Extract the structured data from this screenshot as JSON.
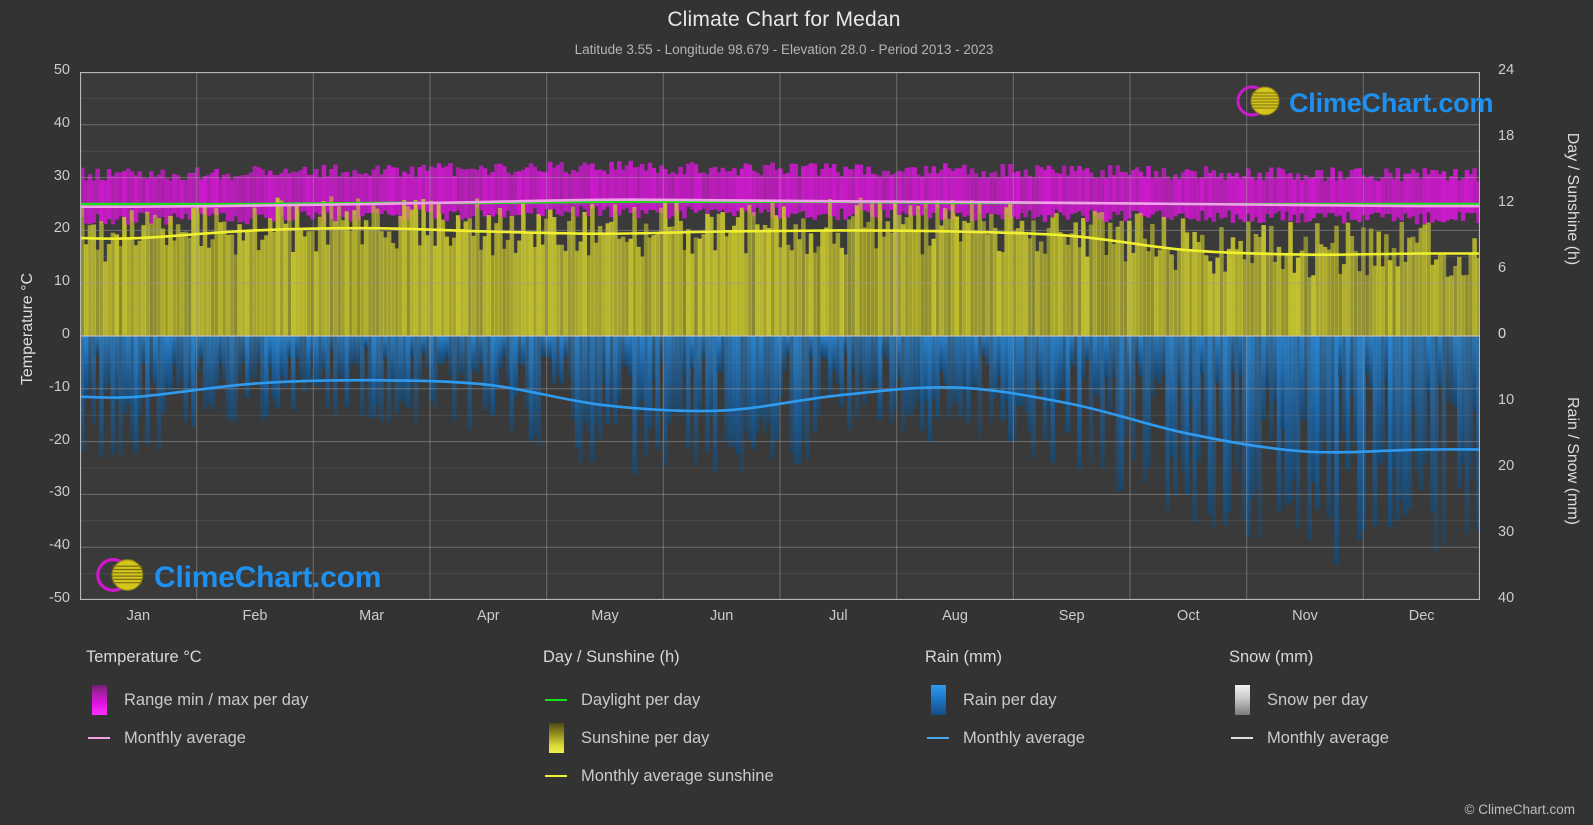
{
  "header": {
    "title": "Climate Chart for Medan",
    "subtitle": "Latitude 3.55 - Longitude 98.679 - Elevation 28.0 - Period 2013 - 2023"
  },
  "axes": {
    "left_title": "Temperature °C",
    "right_top_title": "Day / Sunshine (h)",
    "right_bottom_title": "Rain / Snow (mm)",
    "left_ticks": [
      "50",
      "40",
      "30",
      "20",
      "10",
      "0",
      "-10",
      "-20",
      "-30",
      "-40",
      "-50"
    ],
    "right_top_ticks": [
      "24",
      "18",
      "12",
      "6",
      "0"
    ],
    "right_bottom_ticks": [
      "0",
      "10",
      "20",
      "30",
      "40"
    ],
    "x_ticks": [
      "Jan",
      "Feb",
      "Mar",
      "Apr",
      "May",
      "Jun",
      "Jul",
      "Aug",
      "Sep",
      "Oct",
      "Nov",
      "Dec"
    ]
  },
  "legend": {
    "temperature": {
      "heading": "Temperature °C",
      "items": [
        {
          "label": "Range min / max per day",
          "key": "swatch-magenta"
        },
        {
          "label": "Monthly average",
          "key": "line-pink"
        }
      ]
    },
    "day_sunshine": {
      "heading": "Day / Sunshine (h)",
      "items": [
        {
          "label": "Daylight per day",
          "key": "line-green"
        },
        {
          "label": "Sunshine per day",
          "key": "swatch-yellow"
        },
        {
          "label": "Monthly average sunshine",
          "key": "line-yellow"
        }
      ]
    },
    "rain": {
      "heading": "Rain (mm)",
      "items": [
        {
          "label": "Rain per day",
          "key": "swatch-blue"
        },
        {
          "label": "Monthly average",
          "key": "line-blue"
        }
      ]
    },
    "snow": {
      "heading": "Snow (mm)",
      "items": [
        {
          "label": "Snow per day",
          "key": "swatch-white"
        },
        {
          "label": "Monthly average",
          "key": "line-white"
        }
      ]
    }
  },
  "branding": {
    "wordmark": "ClimeChart.com",
    "footer": "© ClimeChart.com"
  },
  "colors": {
    "background": "#333333",
    "plot_background": "#3a3a3a",
    "grid": "#9a9a9a",
    "temp_range": "#cc19cc",
    "temp_avg_line": "#f3a0ea",
    "daylight_line": "#14e214",
    "sunshine_fill": "#b0ae2c",
    "sunshine_avg_line": "#f0f030",
    "rain_fill": "#1d6fb8",
    "rain_avg_line": "#2e9bf0",
    "brand_blue": "#1e90f0",
    "brand_magenta": "#cc19cc",
    "brand_yellow": "#d4c41e"
  },
  "chart_data": {
    "type": "area",
    "title": "Climate Chart for Medan",
    "subtitle": "Latitude 3.55 - Longitude 98.679 - Elevation 28.0 - Period 2013 - 2023",
    "xlabel": "",
    "ylabel": "Temperature °C",
    "ylim": [
      -50,
      50
    ],
    "y2_top_label": "Day / Sunshine (h)",
    "y2_top_lim": [
      0,
      24
    ],
    "y2_bottom_label": "Rain / Snow (mm)",
    "y2_bottom_lim": [
      0,
      40
    ],
    "grid": true,
    "legend_position": "below",
    "categories": [
      "Jan",
      "Feb",
      "Mar",
      "Apr",
      "May",
      "Jun",
      "Jul",
      "Aug",
      "Sep",
      "Oct",
      "Nov",
      "Dec"
    ],
    "series": [
      {
        "name": "Monthly average temperature",
        "unit": "°C",
        "axis": "left",
        "color": "#f3a0ea",
        "values": [
          24.5,
          24.7,
          25.0,
          25.4,
          25.8,
          25.7,
          25.5,
          25.4,
          25.2,
          25.0,
          24.8,
          24.6
        ]
      },
      {
        "name": "Temperature range max per day",
        "unit": "°C",
        "axis": "left",
        "color": "#cc19cc",
        "values": [
          30.5,
          30.8,
          31.2,
          31.5,
          31.8,
          31.6,
          31.4,
          31.3,
          31.0,
          30.8,
          30.5,
          30.4
        ]
      },
      {
        "name": "Temperature range min per day",
        "unit": "°C",
        "axis": "left",
        "color": "#cc19cc",
        "values": [
          22.3,
          22.4,
          22.8,
          23.2,
          23.6,
          23.4,
          23.2,
          23.1,
          22.9,
          22.8,
          22.6,
          22.4
        ]
      },
      {
        "name": "Daylight per day",
        "unit": "h",
        "axis": "right_top",
        "color": "#14e214",
        "values": [
          12.0,
          12.0,
          12.1,
          12.1,
          12.2,
          12.2,
          12.2,
          12.1,
          12.1,
          12.0,
          12.0,
          12.0
        ]
      },
      {
        "name": "Monthly average sunshine",
        "unit": "h",
        "axis": "right_top",
        "color": "#f0f030",
        "values": [
          8.9,
          9.6,
          9.8,
          9.5,
          9.3,
          9.5,
          9.6,
          9.5,
          9.1,
          7.8,
          7.4,
          7.5
        ]
      },
      {
        "name": "Rain monthly average",
        "unit": "mm",
        "axis": "right_bottom",
        "color": "#2e9bf0",
        "values": [
          9.2,
          7.2,
          6.7,
          7.4,
          10.5,
          11.3,
          9.0,
          7.8,
          10.3,
          14.8,
          17.5,
          17.2
        ]
      },
      {
        "name": "Snow monthly average",
        "unit": "mm",
        "axis": "right_bottom",
        "color": "#dddddd",
        "values": [
          0,
          0,
          0,
          0,
          0,
          0,
          0,
          0,
          0,
          0,
          0,
          0
        ]
      }
    ]
  }
}
